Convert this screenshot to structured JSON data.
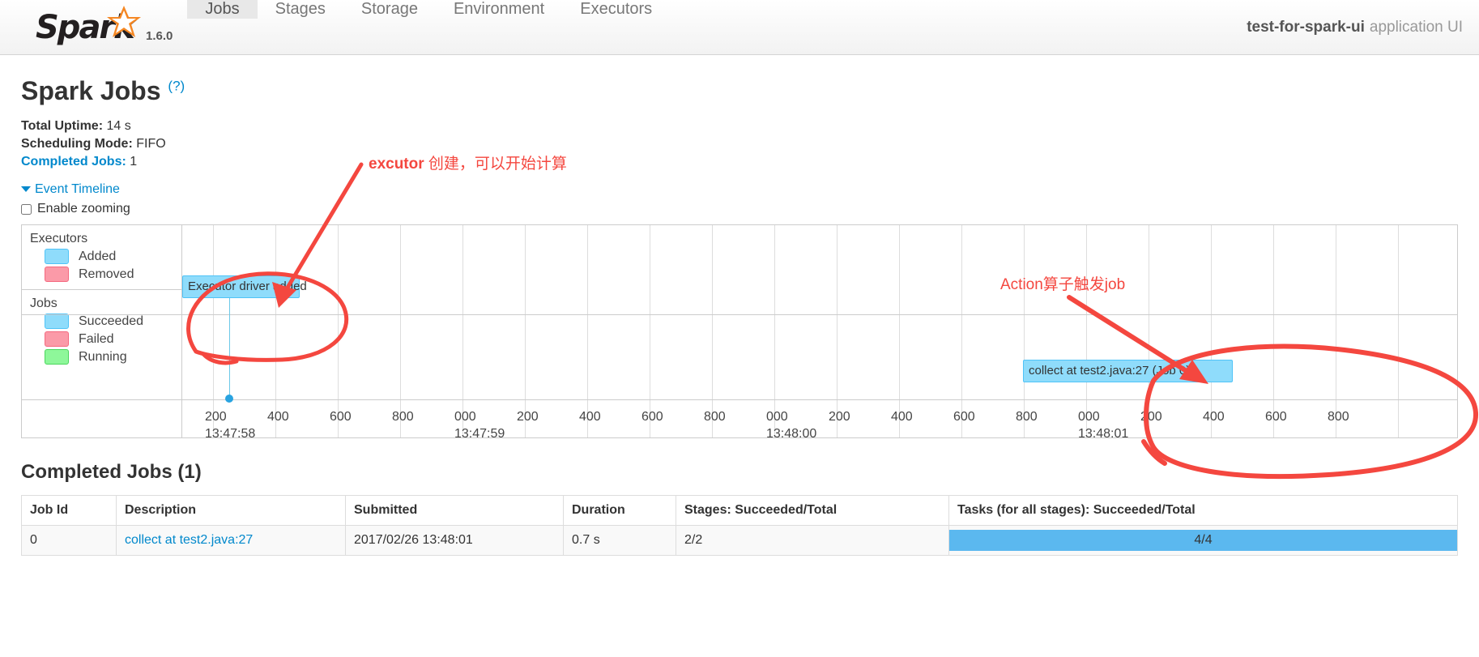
{
  "navbar": {
    "brand_name": "Spark",
    "version": "1.6.0",
    "logo_icon": "spark-star-icon",
    "tabs": [
      {
        "label": "Jobs",
        "active": true
      },
      {
        "label": "Stages",
        "active": false
      },
      {
        "label": "Storage",
        "active": false
      },
      {
        "label": "Environment",
        "active": false
      },
      {
        "label": "Executors",
        "active": false
      }
    ],
    "app_name": "test-for-spark-ui",
    "app_suffix": "application UI"
  },
  "header": {
    "title": "Spark Jobs",
    "help_label": "(?)",
    "total_uptime_label": "Total Uptime:",
    "total_uptime_value": "14 s",
    "scheduling_mode_label": "Scheduling Mode:",
    "scheduling_mode_value": "FIFO",
    "completed_jobs_label": "Completed Jobs:",
    "completed_jobs_value": "1"
  },
  "event_timeline": {
    "toggle_label": "Event Timeline",
    "caret_icon": "caret-down-icon",
    "enable_zooming_label": "Enable zooming",
    "enable_zooming_checked": false,
    "legend": {
      "executors_title": "Executors",
      "executors_items": [
        {
          "label": "Added",
          "color": "#8fdcfb"
        },
        {
          "label": "Removed",
          "color": "#fb9aa8"
        }
      ],
      "jobs_title": "Jobs",
      "jobs_items": [
        {
          "label": "Succeeded",
          "color": "#8fdcfb"
        },
        {
          "label": "Failed",
          "color": "#fb9aa8"
        },
        {
          "label": "Running",
          "color": "#8ef79a"
        }
      ]
    },
    "events": [
      {
        "label": "Executor driver added",
        "type": "executor-added",
        "color": "#8fdcfb"
      },
      {
        "label": "collect at test2.java:27 (Job 0)",
        "type": "job-succeeded",
        "color": "#8fdcfb"
      }
    ],
    "axis_ticks": [
      {
        "ms": "200",
        "sec": "13:47:58"
      },
      {
        "ms": "400",
        "sec": ""
      },
      {
        "ms": "600",
        "sec": ""
      },
      {
        "ms": "800",
        "sec": ""
      },
      {
        "ms": "000",
        "sec": "13:47:59"
      },
      {
        "ms": "200",
        "sec": ""
      },
      {
        "ms": "400",
        "sec": ""
      },
      {
        "ms": "600",
        "sec": ""
      },
      {
        "ms": "800",
        "sec": ""
      },
      {
        "ms": "000",
        "sec": "13:48:00"
      },
      {
        "ms": "200",
        "sec": ""
      },
      {
        "ms": "400",
        "sec": ""
      },
      {
        "ms": "600",
        "sec": ""
      },
      {
        "ms": "800",
        "sec": ""
      },
      {
        "ms": "000",
        "sec": "13:48:01"
      },
      {
        "ms": "200",
        "sec": ""
      },
      {
        "ms": "400",
        "sec": ""
      },
      {
        "ms": "600",
        "sec": ""
      },
      {
        "ms": "800",
        "sec": ""
      }
    ]
  },
  "annotations": {
    "color": "#f4473f",
    "left_note": "excutor 创建，可以开始计算",
    "left_note_bold": "excutor",
    "left_note_rest": " 创建，可以开始计算",
    "right_note": "Action算子触发job"
  },
  "completed_jobs": {
    "section_title": "Completed Jobs (1)",
    "columns": [
      "Job Id",
      "Description",
      "Submitted",
      "Duration",
      "Stages: Succeeded/Total",
      "Tasks (for all stages): Succeeded/Total"
    ],
    "rows": [
      {
        "job_id": "0",
        "description": "collect at test2.java:27",
        "submitted": "2017/02/26 13:48:01",
        "duration": "0.7 s",
        "stages": "2/2",
        "tasks_label": "4/4",
        "tasks_percent": 100
      }
    ]
  }
}
